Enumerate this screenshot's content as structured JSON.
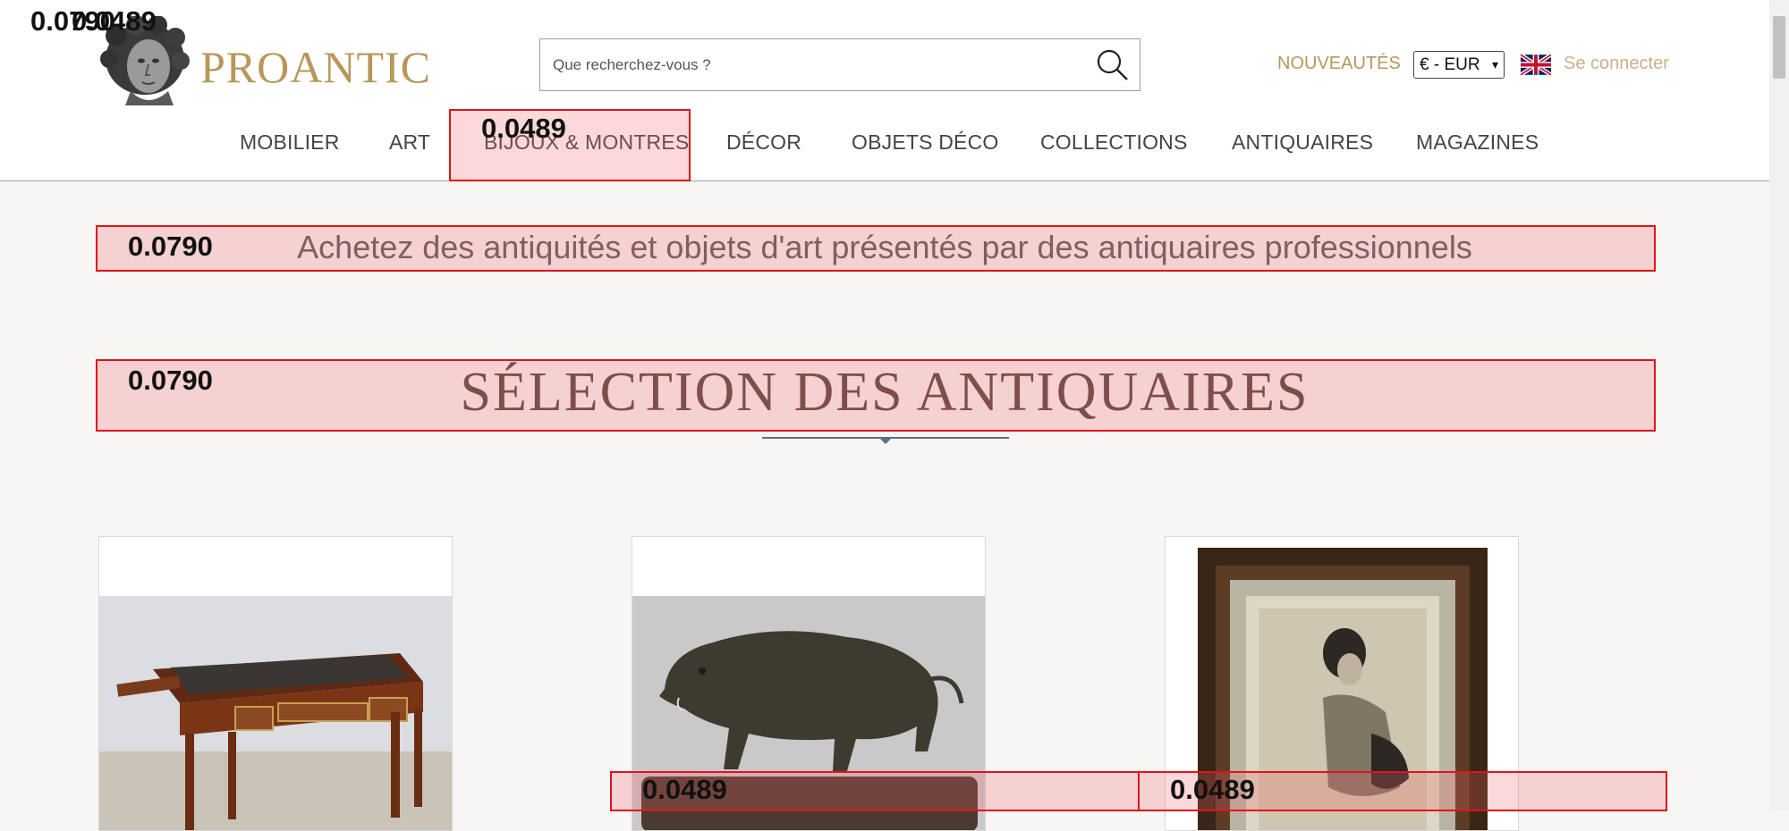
{
  "header": {
    "brand": "PROANTIC",
    "search": {
      "placeholder": "Que recherchez-vous ?"
    },
    "nouveautes": "NOUVEAUTÉS",
    "currency": "€ - EUR",
    "login": "Se connecter",
    "nav": [
      "MOBILIER",
      "ART",
      "BIJOUX & MONTRES",
      "DÉCOR",
      "OBJETS DÉCO",
      "COLLECTIONS",
      "ANTIQUAIRES",
      "MAGAZINES"
    ]
  },
  "main": {
    "tagline": "Achetez des antiquités et objets d'art présentés par des antiquaires professionnels",
    "section_title": "SÉLECTION DES ANTIQUAIRES"
  },
  "overlays": {
    "corner_a": "0.0790",
    "corner_b": "0.0489",
    "nav_box": "0.0489",
    "tagline_box": "0.0790",
    "title_box": "0.0790",
    "bottom_left": "0.0489",
    "bottom_right": "0.0489"
  },
  "colors": {
    "brand": "#b8975a",
    "overlay": "#e3121a"
  }
}
